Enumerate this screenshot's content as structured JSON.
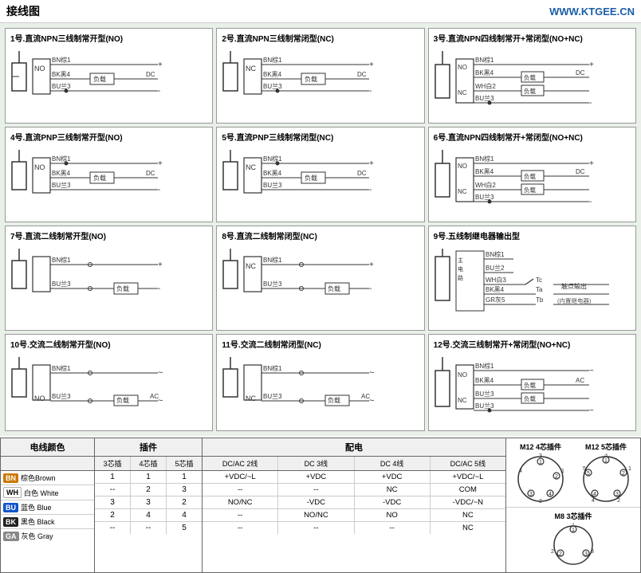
{
  "header": {
    "title": "接线图",
    "url": "WWW.KTGEE.CN"
  },
  "wiring_diagrams": [
    {
      "id": 1,
      "title": "1号.直流NPN三线制常开型(NO)",
      "type": "NPN3_NO"
    },
    {
      "id": 2,
      "title": "2号.直流NPN三线制常闭型(NC)",
      "type": "NPN3_NC"
    },
    {
      "id": 3,
      "title": "3号.直流NPN四线制常开+常闭型(NO+NC)",
      "type": "NPN4_NO_NC"
    },
    {
      "id": 4,
      "title": "4号.直流PNP三线制常开型(NO)",
      "type": "PNP3_NO"
    },
    {
      "id": 5,
      "title": "5号.直流PNP三线制常闭型(NC)",
      "type": "PNP3_NC"
    },
    {
      "id": 6,
      "title": "6号.直流NPN四线制常开+常闭型(NO+NC)",
      "type": "PNP4_NO_NC"
    },
    {
      "id": 7,
      "title": "7号.直流二线制常开型(NO)",
      "type": "DC2_NO"
    },
    {
      "id": 8,
      "title": "8号.直流二线制常闭型(NC)",
      "type": "DC2_NC"
    },
    {
      "id": 9,
      "title": "9号.五线制继电器输出型",
      "type": "RELAY5"
    },
    {
      "id": 10,
      "title": "10号.交流二线制常开型(NO)",
      "type": "AC2_NO"
    },
    {
      "id": 11,
      "title": "11号.交流二线制常闭型(NC)",
      "type": "AC2_NC"
    },
    {
      "id": 12,
      "title": "12号.交流三线制常开+常闭型(NO+NC)",
      "type": "AC3_NO_NC"
    }
  ],
  "table": {
    "wire_color_header": "电线颜色",
    "plugin_header": "插件",
    "power_header": "配电",
    "plugin_sub": [
      "3芯插",
      "4芯插",
      "5芯插"
    ],
    "power_sub": [
      "DC/AC 2线",
      "DC 3线",
      "DC 4线",
      "DC/AC 5线"
    ],
    "rows": [
      {
        "code": "BN",
        "color_en": "棕色Brown",
        "color_tag": "tag-bn",
        "plugin": [
          "1",
          "1",
          "1"
        ],
        "power": [
          "+VDC/~L",
          "+VDC",
          "+VDC",
          "+VDC/~L"
        ]
      },
      {
        "code": "WH",
        "color_en": "白色 White",
        "color_tag": "tag-wh",
        "plugin": [
          "--",
          "2",
          "3"
        ],
        "power": [
          "--",
          "--",
          "NC",
          "COM"
        ]
      },
      {
        "code": "BU",
        "color_en": "蓝色 Blue",
        "color_tag": "tag-bu",
        "plugin": [
          "3",
          "3",
          "2"
        ],
        "power": [
          "NO/NC",
          "-VDC",
          "-VDC",
          "-VDC/~N"
        ]
      },
      {
        "code": "BK",
        "color_en": "黑色 Black",
        "color_tag": "tag-bk",
        "plugin": [
          "2",
          "4",
          "4"
        ],
        "power": [
          "--",
          "NO/NC",
          "NO",
          "NC"
        ]
      },
      {
        "code": "GA",
        "color_en": "灰色 Gray",
        "color_tag": "tag-ga",
        "plugin": [
          "--",
          "--",
          "5"
        ],
        "power": [
          "--",
          "--",
          "--",
          "NC"
        ]
      }
    ],
    "connectors": {
      "m12_4pin_label": "M12 4芯插件",
      "m12_5pin_label": "M12 5芯插件",
      "m8_3pin_label": "M8 3芯插件"
    }
  }
}
